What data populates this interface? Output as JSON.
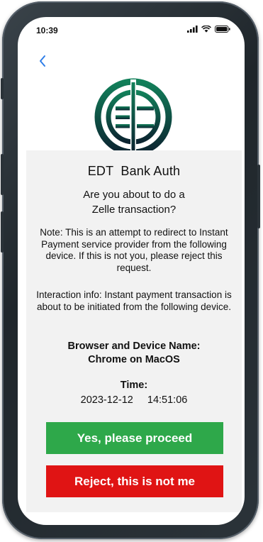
{
  "status_bar": {
    "time": "10:39",
    "icons": [
      "signal-icon",
      "wifi-icon",
      "battery-icon"
    ]
  },
  "nav": {
    "back_icon": "chevron-left-icon"
  },
  "logo": {
    "icon": "edt-logo",
    "colors": [
      "#0f6b4a",
      "#0b2330"
    ]
  },
  "auth": {
    "title": "EDT  Bank Auth",
    "question_line1": "Are you about to do a",
    "question_line2": "Zelle transaction?",
    "note": "Note: This is an attempt to redirect to Instant Payment service provider from the following device. If this is not you, please reject this request.",
    "interaction_info": "Interaction info: Instant payment transaction is about to be initiated from the following device.",
    "device_label": "Browser and Device Name:",
    "device_value": "Chrome on MacOS",
    "time_label": "Time:",
    "time_value": "2023-12-12  14:51:06"
  },
  "actions": {
    "proceed_label": "Yes, please proceed",
    "reject_label": "Reject, this is not me",
    "proceed_color": "#2ea84a",
    "reject_color": "#e01414"
  }
}
